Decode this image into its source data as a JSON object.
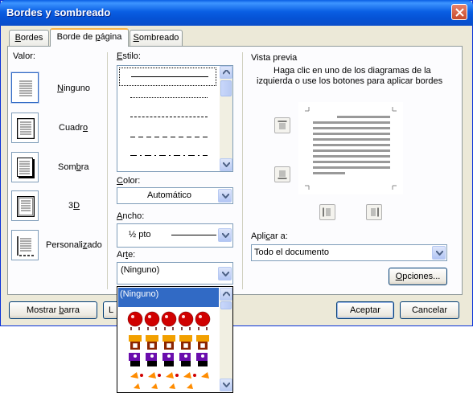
{
  "window": {
    "title": "Bordes y sombreado"
  },
  "tabs": [
    {
      "label": "Bordes",
      "underline": "B",
      "rest": "ordes"
    },
    {
      "label": "Borde de página",
      "prefix": "Borde de ",
      "underline": "p",
      "rest": "ágina"
    },
    {
      "label": "Sombreado",
      "underline": "S",
      "rest": "ombreado"
    }
  ],
  "valor": {
    "heading": "Valor:",
    "options": [
      {
        "label": "Ninguno",
        "prefix": "",
        "underline": "N",
        "rest": "inguno"
      },
      {
        "label": "Cuadro",
        "prefix": "Cuadr",
        "underline": "o",
        "rest": ""
      },
      {
        "label": "Sombra",
        "prefix": "Som",
        "underline": "b",
        "rest": "ra"
      },
      {
        "label": "3D",
        "prefix": "3",
        "underline": "D",
        "rest": ""
      },
      {
        "label": "Personalizado",
        "prefix": "Personali",
        "underline": "z",
        "rest": "ado"
      }
    ]
  },
  "estilo": {
    "label_u": "E",
    "label_rest": "stilo:"
  },
  "color": {
    "label_u": "C",
    "label_rest": "olor:",
    "value": "Automático"
  },
  "ancho": {
    "label_u": "A",
    "label_rest": "ncho:",
    "value": "½ pto"
  },
  "arte": {
    "label_pre": "Ar",
    "label_u": "t",
    "label_rest": "e:",
    "value": "(Ninguno)",
    "list_selected": "(Ninguno)"
  },
  "preview": {
    "heading": "Vista previa",
    "instructions_line1": "Haga clic en uno de los diagramas de la",
    "instructions_line2": "izquierda o use los botones para aplicar bordes"
  },
  "apply": {
    "label_pre": "Apli",
    "label_u": "c",
    "label_rest": "ar a:",
    "value": "Todo el documento"
  },
  "buttons": {
    "opciones": "Opciones...",
    "opciones_u": "O",
    "opciones_rest": "pciones...",
    "mostrar_pre": "Mostrar ",
    "mostrar_u": "b",
    "mostrar_rest": "arra",
    "linea_h": "L",
    "aceptar": "Aceptar",
    "cancelar": "Cancelar"
  },
  "colors": {
    "titlebar": "#0a5fe4",
    "selection": "#316ac5",
    "tab_accent": "#f7b349"
  }
}
